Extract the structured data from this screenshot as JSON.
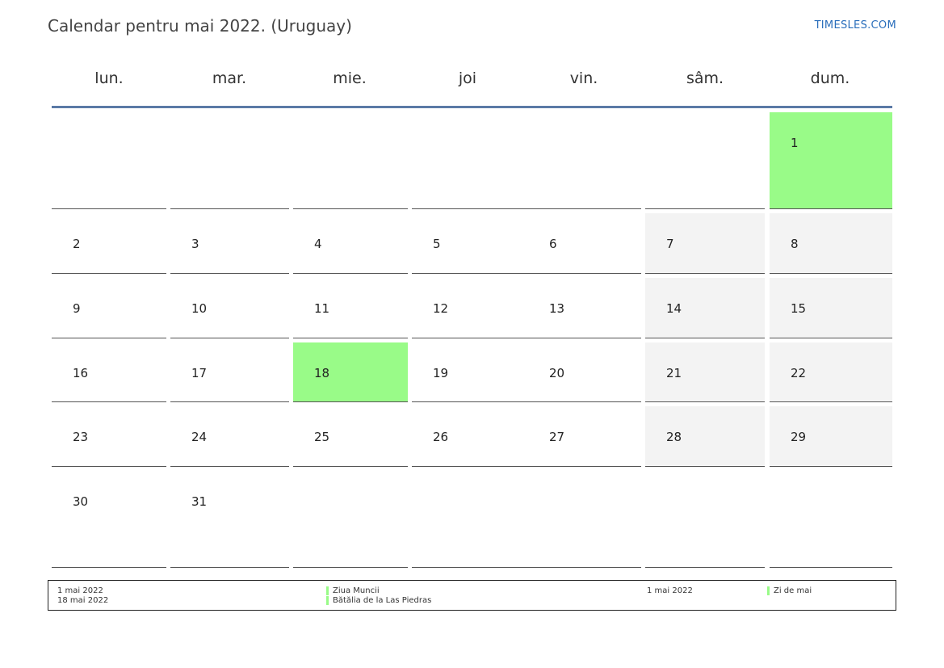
{
  "header": {
    "title": "Calendar pentru mai 2022. (Uruguay)",
    "brand": "TIMESLES.COM"
  },
  "weekdays": [
    "lun.",
    "mar.",
    "mie.",
    "joi",
    "vin.",
    "sâm.",
    "dum."
  ],
  "colors": {
    "holiday": "#99fb88",
    "weekend": "#f3f3f3",
    "header_rule": "#5b7aa6",
    "brand": "#2a6ebb"
  },
  "weeks": [
    [
      "",
      "",
      "",
      "",
      "",
      "",
      "1"
    ],
    [
      "2",
      "3",
      "4",
      "5",
      "6",
      "7",
      "8"
    ],
    [
      "9",
      "10",
      "11",
      "12",
      "13",
      "14",
      "15"
    ],
    [
      "16",
      "17",
      "18",
      "19",
      "20",
      "21",
      "22"
    ],
    [
      "23",
      "24",
      "25",
      "26",
      "27",
      "28",
      "29"
    ],
    [
      "30",
      "31",
      "",
      "",
      "",
      "",
      ""
    ]
  ],
  "holiday_days": [
    "1",
    "18"
  ],
  "legend": {
    "dates": [
      "1 mai 2022",
      "18 mai 2022"
    ],
    "names": [
      "Ziua Muncii",
      "Bătălia de la Las Piedras"
    ],
    "dates2": [
      "1 mai 2022"
    ],
    "names2": [
      "Zi de mai"
    ]
  }
}
